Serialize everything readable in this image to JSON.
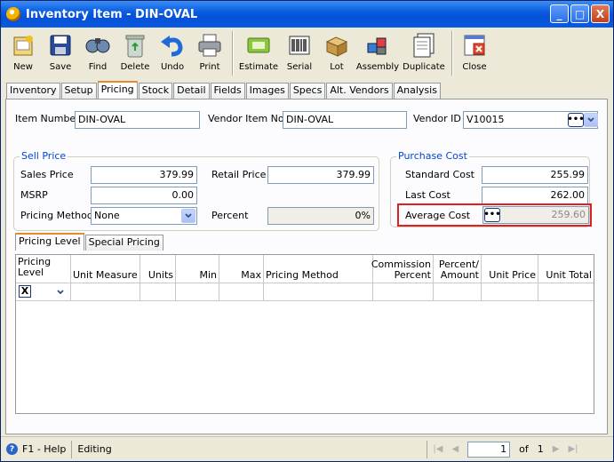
{
  "window": {
    "title": "Inventory Item - DIN-OVAL",
    "min": "_",
    "max": "□",
    "close": "X"
  },
  "toolbar": [
    {
      "label": "New",
      "icon": "new-icon"
    },
    {
      "label": "Save",
      "icon": "save-icon"
    },
    {
      "label": "Find",
      "icon": "find-icon"
    },
    {
      "label": "Delete",
      "icon": "delete-icon"
    },
    {
      "label": "Undo",
      "icon": "undo-icon"
    },
    {
      "label": "Print",
      "icon": "print-icon"
    },
    {
      "label": "Estimate",
      "icon": "estimate-icon"
    },
    {
      "label": "Serial",
      "icon": "serial-icon"
    },
    {
      "label": "Lot",
      "icon": "lot-icon"
    },
    {
      "label": "Assembly",
      "icon": "assembly-icon"
    },
    {
      "label": "Duplicate",
      "icon": "duplicate-icon"
    },
    {
      "label": "Close",
      "icon": "close-icon"
    }
  ],
  "tabs": [
    "Inventory",
    "Setup",
    "Pricing",
    "Stock",
    "Detail",
    "Fields",
    "Images",
    "Specs",
    "Alt. Vendors",
    "Analysis"
  ],
  "active_tab": "Pricing",
  "header": {
    "item_number_label": "Item Number",
    "item_number": "DIN-OVAL",
    "vendor_item_label": "Vendor Item No",
    "vendor_item": "DIN-OVAL",
    "vendor_id_label": "Vendor ID",
    "vendor_id": "V10015"
  },
  "sell_price": {
    "title": "Sell Price",
    "sales_price_label": "Sales Price",
    "sales_price": "379.99",
    "msrp_label": "MSRP",
    "msrp": "0.00",
    "pricing_method_label": "Pricing Method",
    "pricing_method": "None",
    "retail_price_label": "Retail Price",
    "retail_price": "379.99",
    "percent_label": "Percent",
    "percent": "0%"
  },
  "purchase_cost": {
    "title": "Purchase Cost",
    "standard_cost_label": "Standard Cost",
    "standard_cost": "255.99",
    "last_cost_label": "Last Cost",
    "last_cost": "262.00",
    "average_cost_label": "Average Cost",
    "average_cost": "259.60",
    "highlight_color": "#e02020"
  },
  "subtabs": [
    "Pricing Level",
    "Special Pricing"
  ],
  "grid": {
    "headers": [
      "Pricing Level",
      "Unit Measure",
      "Units",
      "Min",
      "Max",
      "Pricing Method",
      "Commission Percent",
      "Percent/ Amount",
      "Unit Price",
      "Unit Total"
    ],
    "first_row_checkbox": "X"
  },
  "status": {
    "help": "F1 - Help",
    "mode": "Editing",
    "page": "1",
    "of_label": "of",
    "total": "1"
  }
}
